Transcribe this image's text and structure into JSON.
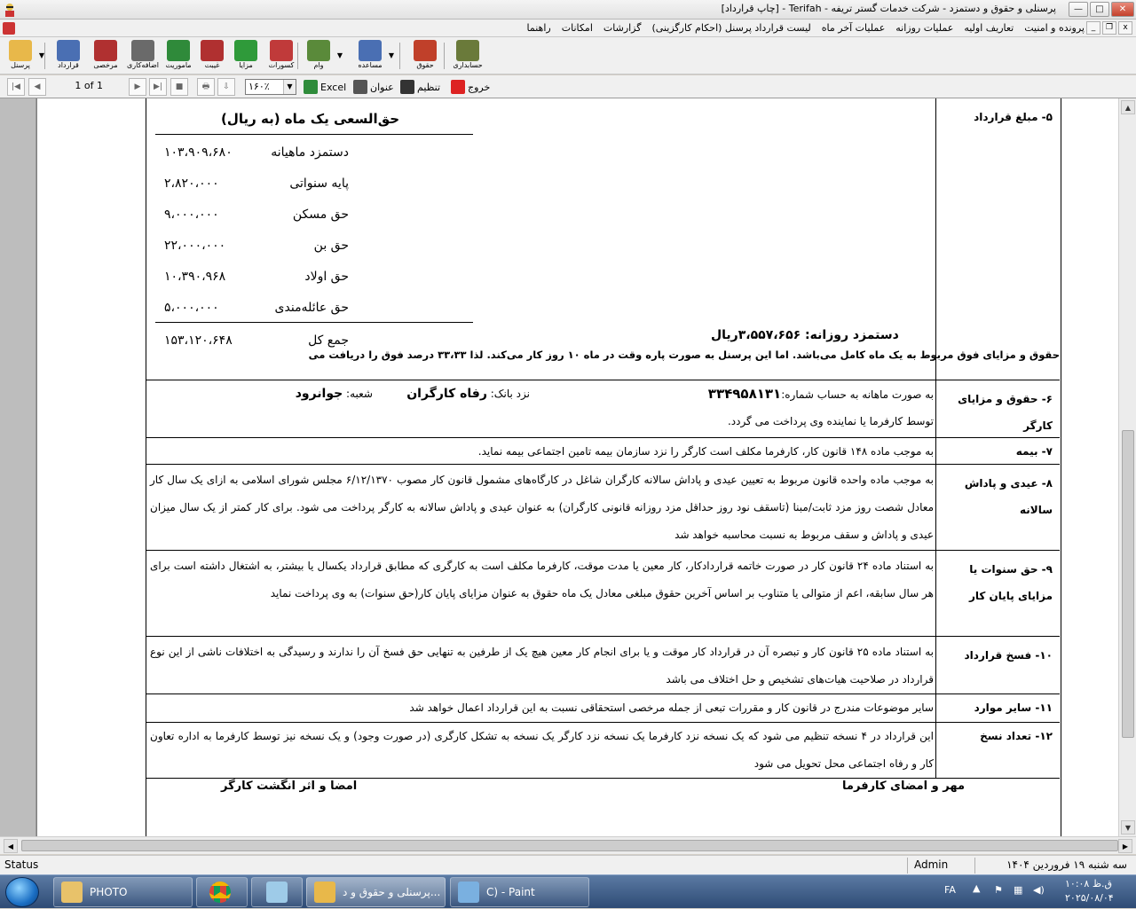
{
  "window": {
    "title": "پرسنلی و حقوق و دستمزد - شرکت خدمات گستر تریفه - Terifah - [چاپ قرارداد]",
    "min": "—",
    "max": "□",
    "close": "✕"
  },
  "menu": {
    "items": [
      "پرونده و امنیت",
      "تعاریف اولیه",
      "عملیات روزانه",
      "عملیات آخر ماه",
      "لیست قرارداد پرسنل (احکام کارگزینی)",
      "گزارشات",
      "امکانات",
      "راهنما"
    ],
    "mdi_min": "_",
    "mdi_restore": "❐",
    "mdi_close": "x"
  },
  "toolbar": {
    "buttons": [
      {
        "label": "پرسنل",
        "color": "#e8b84a"
      },
      {
        "label": "قرارداد",
        "color": "#4a6fb3"
      },
      {
        "label": "مرخصی",
        "color": "#b03030"
      },
      {
        "label": "اضافه‌کاری",
        "color": "#6a6a6a"
      },
      {
        "label": "ماموریت",
        "color": "#2f8a3a"
      },
      {
        "label": "غیبت",
        "color": "#b03030"
      },
      {
        "label": "مزایا",
        "color": "#2f9a3a"
      },
      {
        "label": "کسورات",
        "color": "#c03a3a"
      },
      {
        "label": "وام",
        "color": "#5a8a3a"
      },
      {
        "label": "مساعده",
        "color": "#4a6fb3"
      },
      {
        "label": "حقوق",
        "color": "#c0402a"
      },
      {
        "label": "حسابداری",
        "color": "#6a7a3a"
      }
    ]
  },
  "report_toolbar": {
    "page": "1 of 1",
    "zoom": "۱۶۰٪",
    "excel": "Excel",
    "title_btn": "عنوان",
    "setup": "تنظیم",
    "exit": "خروج"
  },
  "contract": {
    "row5": {
      "label": "۵- مبلغ قرارداد",
      "salary_title": "حق‌السعی یک ماه (به ریال)",
      "items": [
        {
          "name": "دستمزد ماهیانه",
          "value": "۱۰۳،۹۰۹،۶۸۰"
        },
        {
          "name": "پایه سنواتی",
          "value": "۲،۸۲۰،۰۰۰"
        },
        {
          "name": "حق مسکن",
          "value": "۹،۰۰۰،۰۰۰"
        },
        {
          "name": "حق بن",
          "value": "۲۲،۰۰۰،۰۰۰"
        },
        {
          "name": "حق اولاد",
          "value": "۱۰،۳۹۰،۹۶۸"
        },
        {
          "name": "حق عائله‌مندی",
          "value": "۵،۰۰۰،۰۰۰"
        }
      ],
      "total_label": "جمع کل",
      "total_value": "۱۵۳،۱۲۰،۶۴۸",
      "daily": "دستمزد روزانه: ۳،۵۵۷،۶۵۶ریال",
      "note": "حقوق و مزایای فوق مربوط به یک ماه کامل می‌باشد. اما این پرسنل به صورت پاره وقت در ماه ۱۰ روز کار می‌کند. لذا ۳۳،۳۳ درصد فوق را دریافت می"
    },
    "row6": {
      "label": "۶- حقوق و مزایای کارگر",
      "line1_a": "به صورت ماهانه به حساب شماره:",
      "account": "۳۳۴۹۵۸۱۳۱",
      "bank_label": "نزد بانک:",
      "bank": "رفاه کارگران",
      "branch_label": "شعبه:",
      "branch": "جوانرود",
      "line2": "توسط کارفرما یا نماینده وی پرداخت می گردد."
    },
    "row7": {
      "label": "۷- بیمه",
      "text": "به موجب ماده ۱۴۸ قانون کار، کارفرما مکلف است کارگر را نزد سازمان بیمه تامین اجتماعی بیمه نماید."
    },
    "row8": {
      "label": "۸- عیدی و پاداش سالانه",
      "text": "به موجب ماده واحده قانون مربوط به تعیین عیدی و پاداش سالانه کارگران شاغل در کارگاه‌های مشمول قانون کار مصوب ۶/۱۲/۱۳۷۰ مجلس شورای اسلامی به ازای یک سال کار معادل شصت روز مزد ثابت/مبنا (تاسقف نود روز حداقل مزد روزانه قانونی کارگران) به عنوان عیدی و پاداش سالانه به کارگر پرداخت می شود. برای کار کمتر از یک سال میزان عیدی و پاداش و سقف مربوط به نسبت محاسبه خواهد شد"
    },
    "row9": {
      "label": "۹- حق سنوات یا مزایای پایان کار",
      "text": "به استناد ماده ۲۴ قانون کار در صورت خاتمه قرارداد‌کار، کار معین یا مدت موقت، کارفرما مکلف است به کارگری که مطابق قرارداد یکسال یا بیشتر، به اشتغال داشته است برای هر سال سابقه، اعم از متوالی یا متناوب بر اساس آخرین حقوق مبلغی معادل یک ماه حقوق به عنوان مزایای پایان کار(حق سنوات) به وی پرداخت نماید"
    },
    "row10": {
      "label": "۱۰- فسخ قرارداد",
      "text": "به استناد ماده ۲۵ قانون کار و تبصره آن در قرارداد کار موقت و یا برای انجام کار معین هیچ یک از طرفین به تنهایی حق فسخ آن را ندارند و رسیدگی به اختلافات ناشی از این نوع قرارداد در صلاحیت هیات‌های تشخیص و حل اختلاف می باشد"
    },
    "row11": {
      "label": "۱۱- سایر موارد",
      "text": "سایر موضوعات مندرج در قانون کار و مقررات تبعی از جمله مرخصی استحقاقی نسبت به این قرارداد اعمال خواهد شد"
    },
    "row12": {
      "label": "۱۲- تعداد نسخ",
      "text": "این قرارداد در ۴ نسخه تنظیم می شود که یک نسخه نزد کارفرما یک نسخه نزد کارگر یک نسخه به تشکل کارگری (در صورت وجود) و یک نسخه نیز توسط کارفرما به اداره تعاون کار و رفاه اجتماعی محل تحویل می شود"
    },
    "sign_employer": "مهر و امضای کارفرما",
    "sign_worker": "امضا و اثر انگشت کارگر"
  },
  "status": {
    "left": "Status",
    "user": "Admin",
    "date": "سه شنبه ۱۹ فروردین ۱۴۰۴"
  },
  "taskbar": {
    "items": [
      "PHOTO",
      "",
      "",
      "پرسنلی و حقوق و د...",
      "C) - Paint"
    ],
    "lang": "FA",
    "time": "ق.ظ ۱۰:۰۸",
    "date": "۲۰۲۵/۰۸/۰۴"
  }
}
